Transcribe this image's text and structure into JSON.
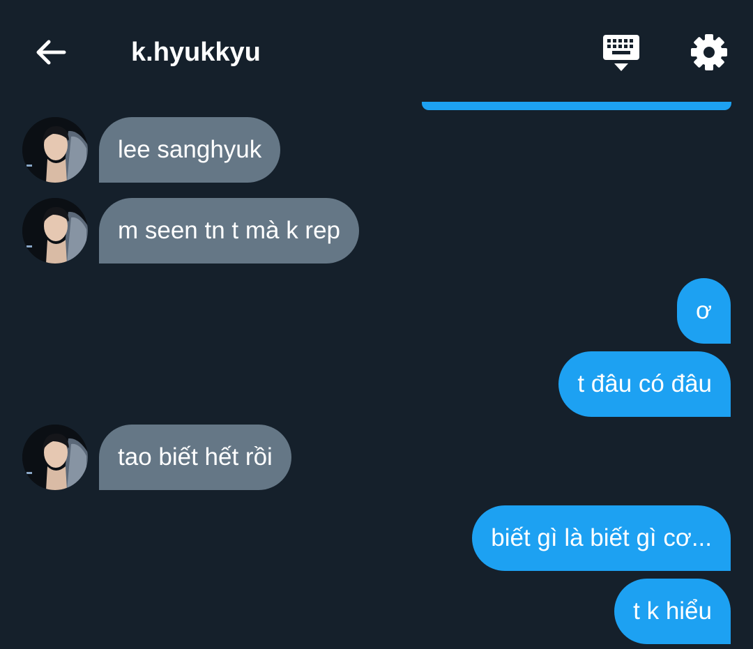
{
  "header": {
    "title": "k.hyukkyu",
    "icons": {
      "back": "arrow-left-icon",
      "keyboard": "keyboard-icon",
      "settings": "gear-icon"
    }
  },
  "colors": {
    "background": "#15202b",
    "outgoing_bubble": "#1da1f2",
    "incoming_bubble": "#657786",
    "text": "#ffffff"
  },
  "messages": [
    {
      "direction": "incoming",
      "text": "lee sanghyuk"
    },
    {
      "direction": "incoming",
      "text": "m seen tn t mà k rep"
    },
    {
      "direction": "outgoing",
      "text": "ơ"
    },
    {
      "direction": "outgoing",
      "text": "t đâu có đâu"
    },
    {
      "direction": "incoming",
      "text": "tao biết hết rồi"
    },
    {
      "direction": "outgoing",
      "text": "biết gì là biết gì cơ..."
    },
    {
      "direction": "outgoing",
      "text": "t k hiểu"
    }
  ]
}
